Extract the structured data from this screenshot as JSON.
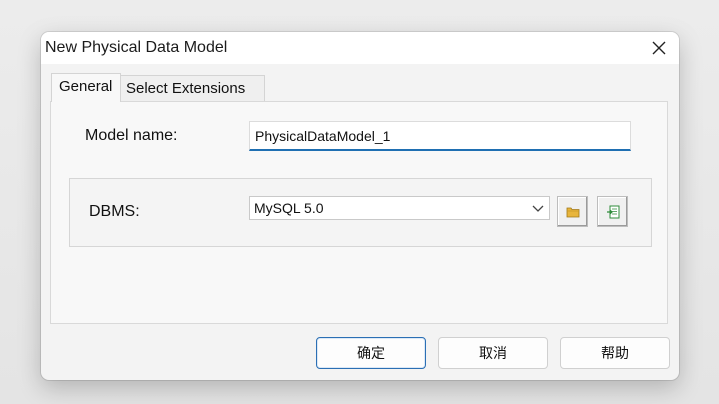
{
  "dialog": {
    "title": "New Physical Data Model",
    "close_icon": "close-icon"
  },
  "tabs": [
    {
      "label": "General",
      "active": true
    },
    {
      "label": "Select Extensions",
      "active": false
    }
  ],
  "general": {
    "model_name_label": "Model name:",
    "model_name_value": "PhysicalDataModel_1",
    "dbms_label": "DBMS:",
    "dbms_selected": "MySQL 5.0",
    "dbms_dropdown_icon": "chevron-down-icon",
    "browse_icon": "folder-icon",
    "properties_icon": "open-properties-icon"
  },
  "buttons": {
    "ok_label": "确定",
    "cancel_label": "取消",
    "help_label": "帮助"
  },
  "colors": {
    "accent": "#1f6fb2",
    "primary_button_border": "#2b6fb4",
    "folder_icon": "#e8b53c",
    "properties_icon": "#2e8b3a"
  }
}
